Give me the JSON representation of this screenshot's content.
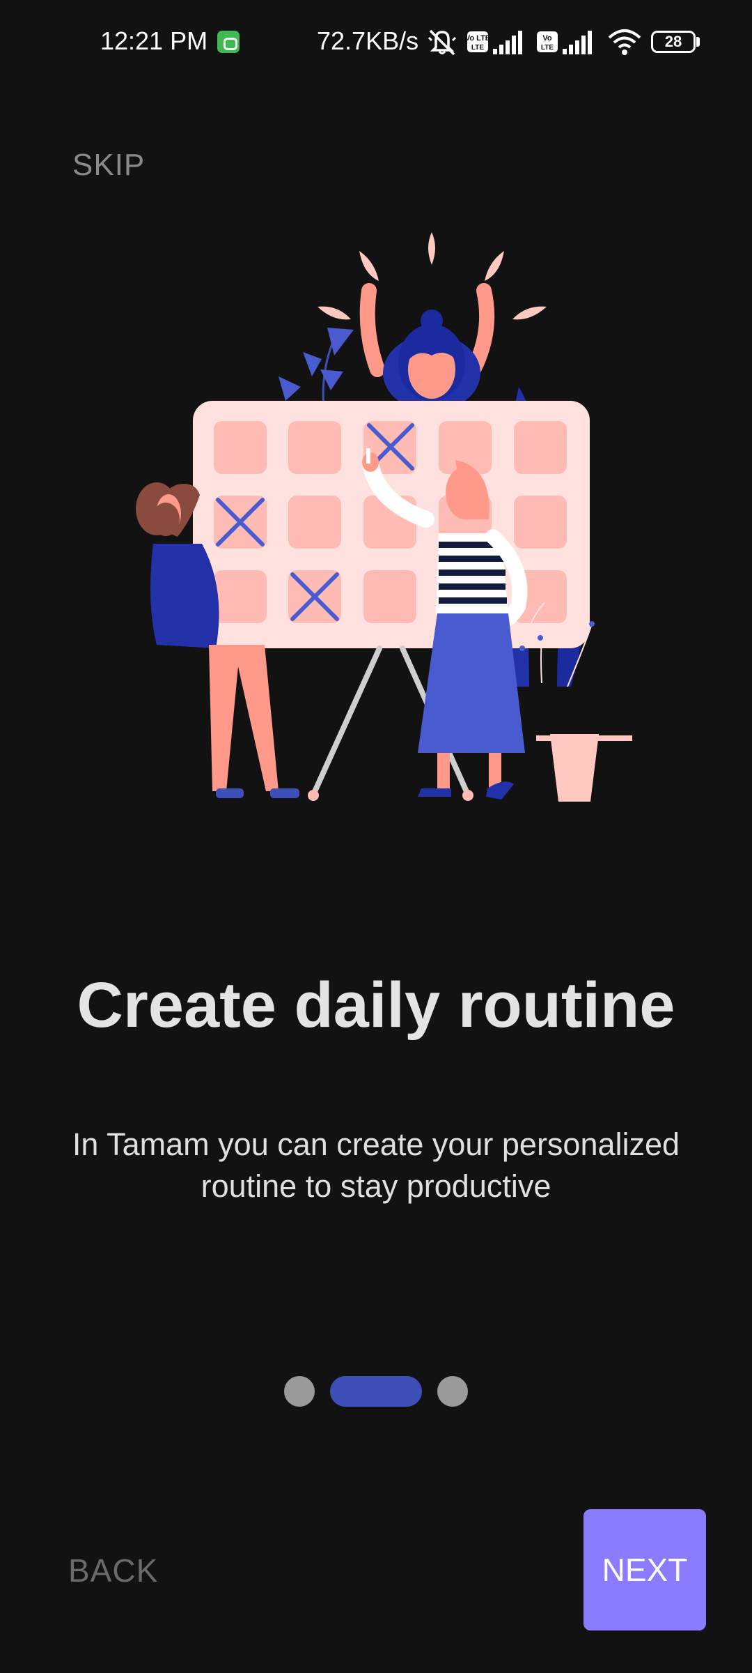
{
  "status_bar": {
    "time": "12:21 PM",
    "speed": "72.7KB/s",
    "volte_label": "Vo LTE",
    "battery": "28",
    "icons": [
      "app-notification-icon",
      "mute-icon",
      "volte-icon",
      "signal-icon",
      "volte-icon",
      "signal-icon",
      "wifi-icon",
      "battery-icon"
    ]
  },
  "onboarding": {
    "skip_label": "SKIP",
    "title": "Create daily routine",
    "description": "In Tamam you can create your personalized routine to stay productive",
    "page_count": 3,
    "current_page": 2
  },
  "navigation": {
    "back_label": "BACK",
    "next_label": "NEXT"
  },
  "colors": {
    "background": "#121212",
    "accent": "#8b7cff",
    "indicator_active": "#3f4fb8",
    "indicator_inactive": "#9a9a9a"
  }
}
